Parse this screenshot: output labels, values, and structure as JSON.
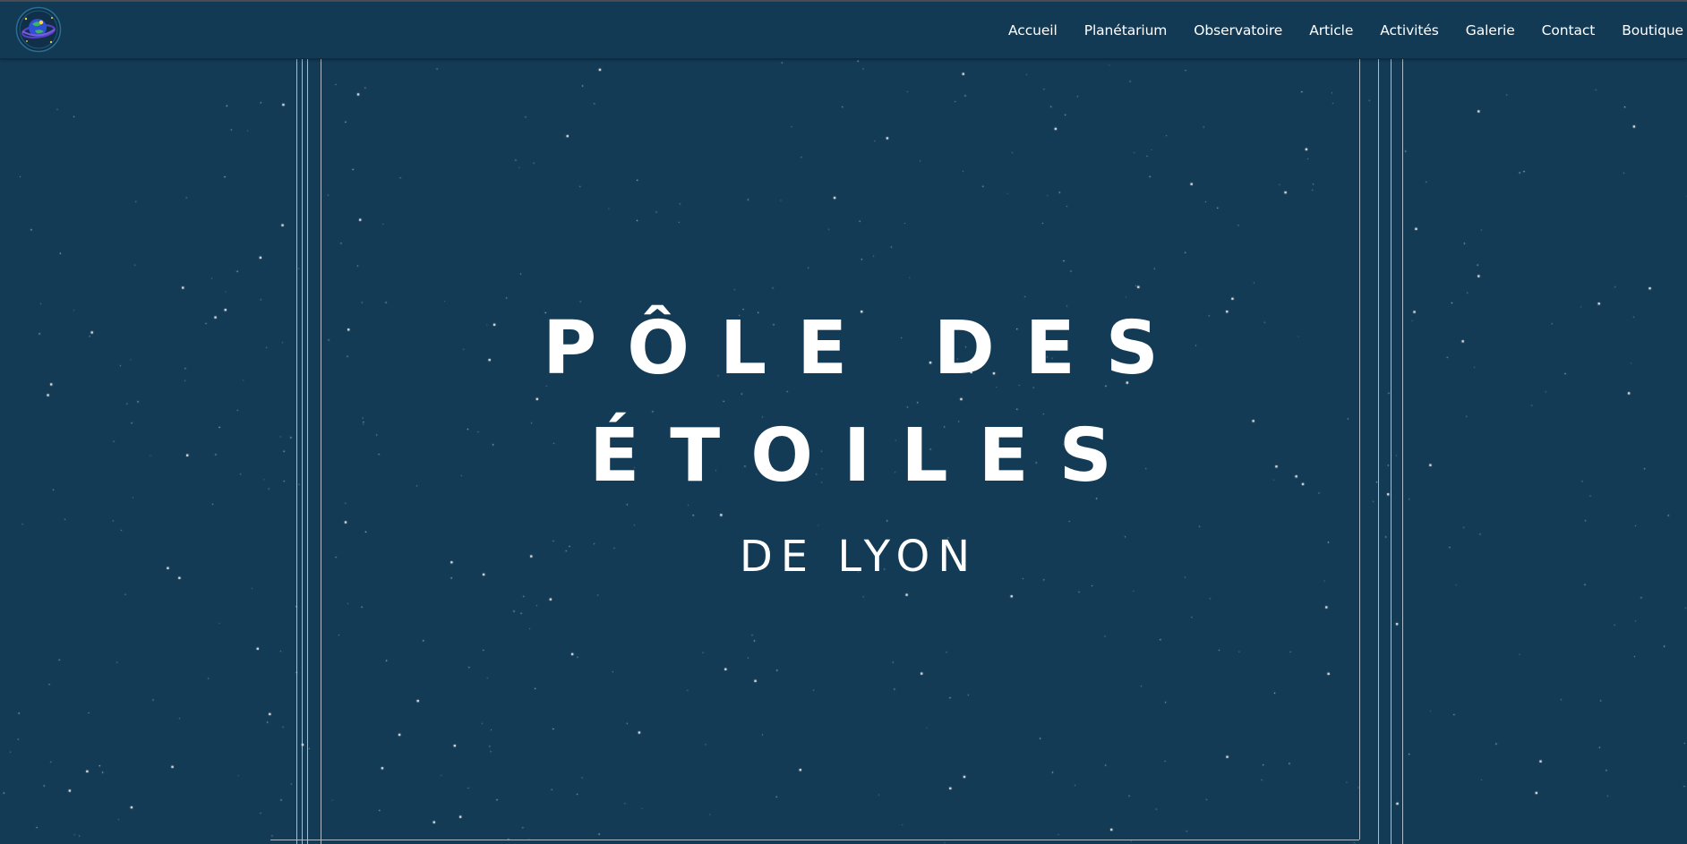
{
  "site": {
    "logo_icon": "planet-globe-logo-icon"
  },
  "nav": {
    "items": [
      {
        "label": "Accueil"
      },
      {
        "label": "Planétarium"
      },
      {
        "label": "Observatoire"
      },
      {
        "label": "Article"
      },
      {
        "label": "Activités"
      },
      {
        "label": "Galerie"
      },
      {
        "label": "Contact"
      },
      {
        "label": "Boutique"
      }
    ]
  },
  "hero": {
    "title_line1": "PÔLE DES",
    "title_line2": "ÉTOILES",
    "subtitle": "DE LYON"
  },
  "theme": {
    "background": "#143b56",
    "navbar": "#133a55",
    "text": "#ffffff",
    "frame_lines": "#c9d3dc"
  }
}
